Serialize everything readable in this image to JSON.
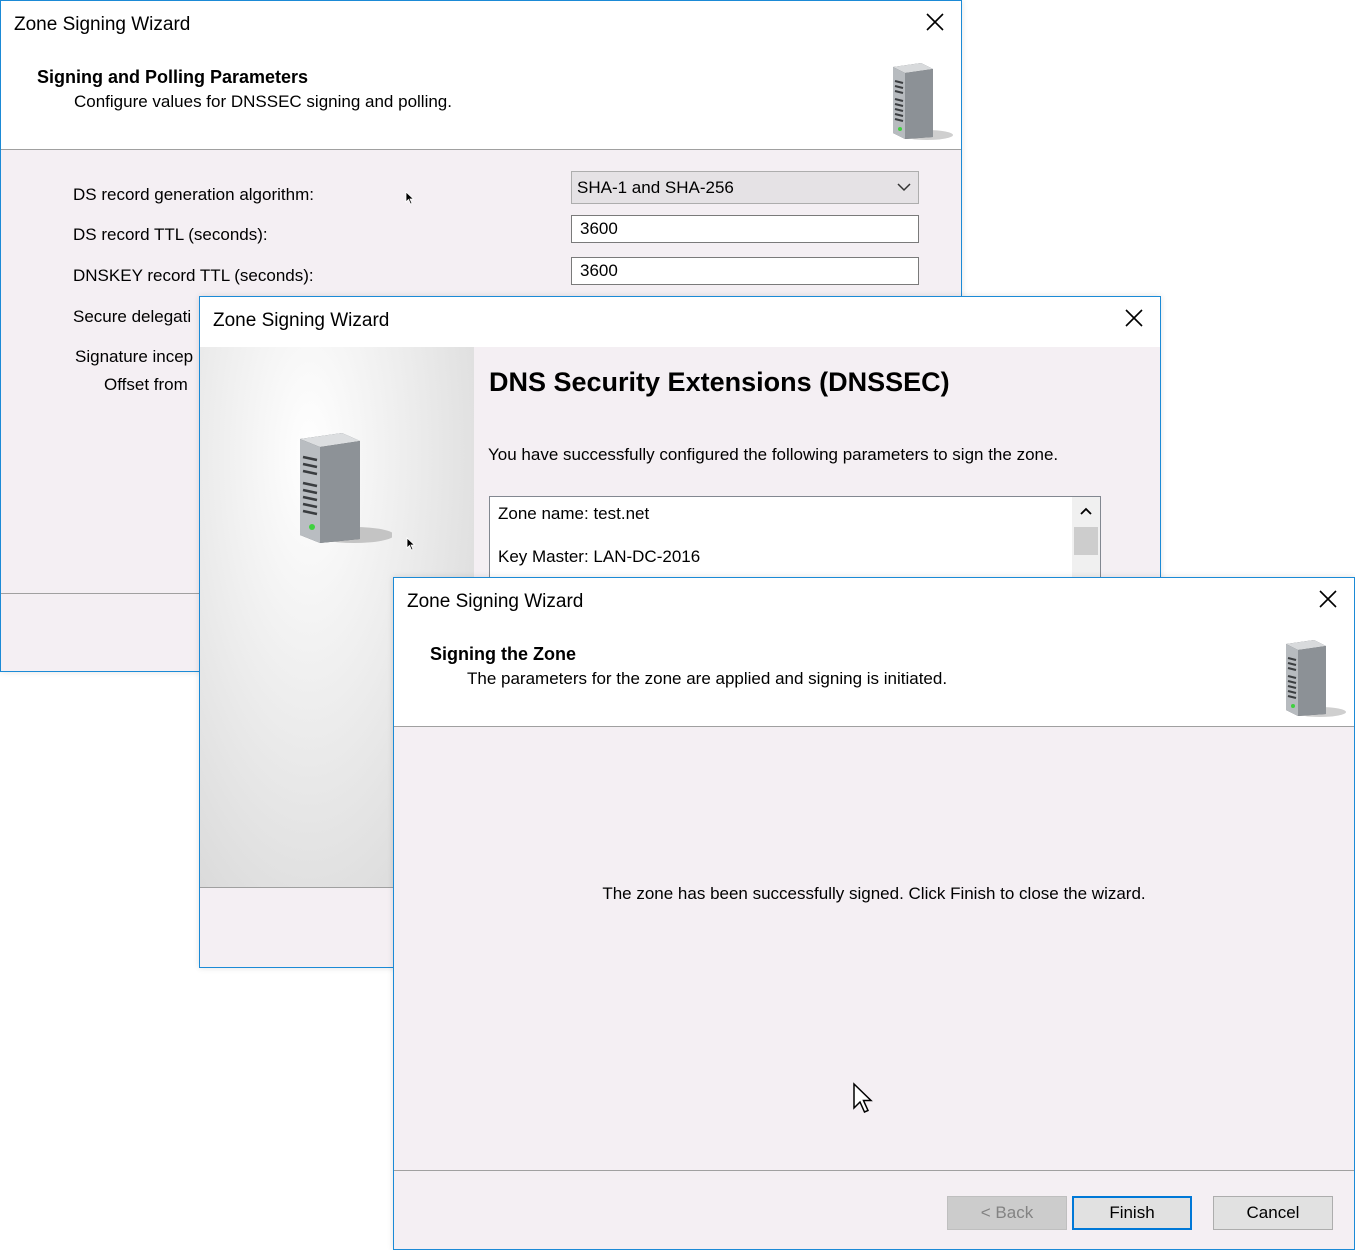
{
  "params_wizard": {
    "title": "Zone Signing Wizard",
    "heading": "Signing and Polling Parameters",
    "subheading": "Configure values for DNSSEC signing and polling.",
    "fields": {
      "ds_algorithm_label": "DS record generation algorithm:",
      "ds_algorithm_value": "SHA-1 and SHA-256",
      "ds_ttl_label": "DS record TTL (seconds):",
      "ds_ttl_value": "3600",
      "dnskey_ttl_label": "DNSKEY record TTL (seconds):",
      "dnskey_ttl_value": "3600",
      "secure_delegation_label": "Secure delegati",
      "signature_inception_label": "Signature incep",
      "offset_label": "Offset from"
    }
  },
  "dnssec_wizard": {
    "title": "Zone Signing Wizard",
    "heading": "DNS Security Extensions (DNSSEC)",
    "intro": "You have successfully configured the following parameters to sign the zone.",
    "summary_lines": [
      "Zone name: test.net",
      "Key Master: LAN-DC-2016"
    ]
  },
  "signing_wizard": {
    "title": "Zone Signing Wizard",
    "heading": "Signing the Zone",
    "subheading": "The parameters for the zone are applied and signing is initiated.",
    "message": "The zone has been successfully signed. Click Finish to close the wizard.",
    "buttons": {
      "back": "< Back",
      "finish": "Finish",
      "cancel": "Cancel"
    }
  },
  "icons": [
    "close-icon",
    "server-icon",
    "chevron-down-icon",
    "scroll-up-icon",
    "mouse-pointer-icon"
  ],
  "colors": {
    "window_border": "#1b8ad6",
    "window_body": "#f4eff3",
    "default_button_border": "#0078d7"
  }
}
